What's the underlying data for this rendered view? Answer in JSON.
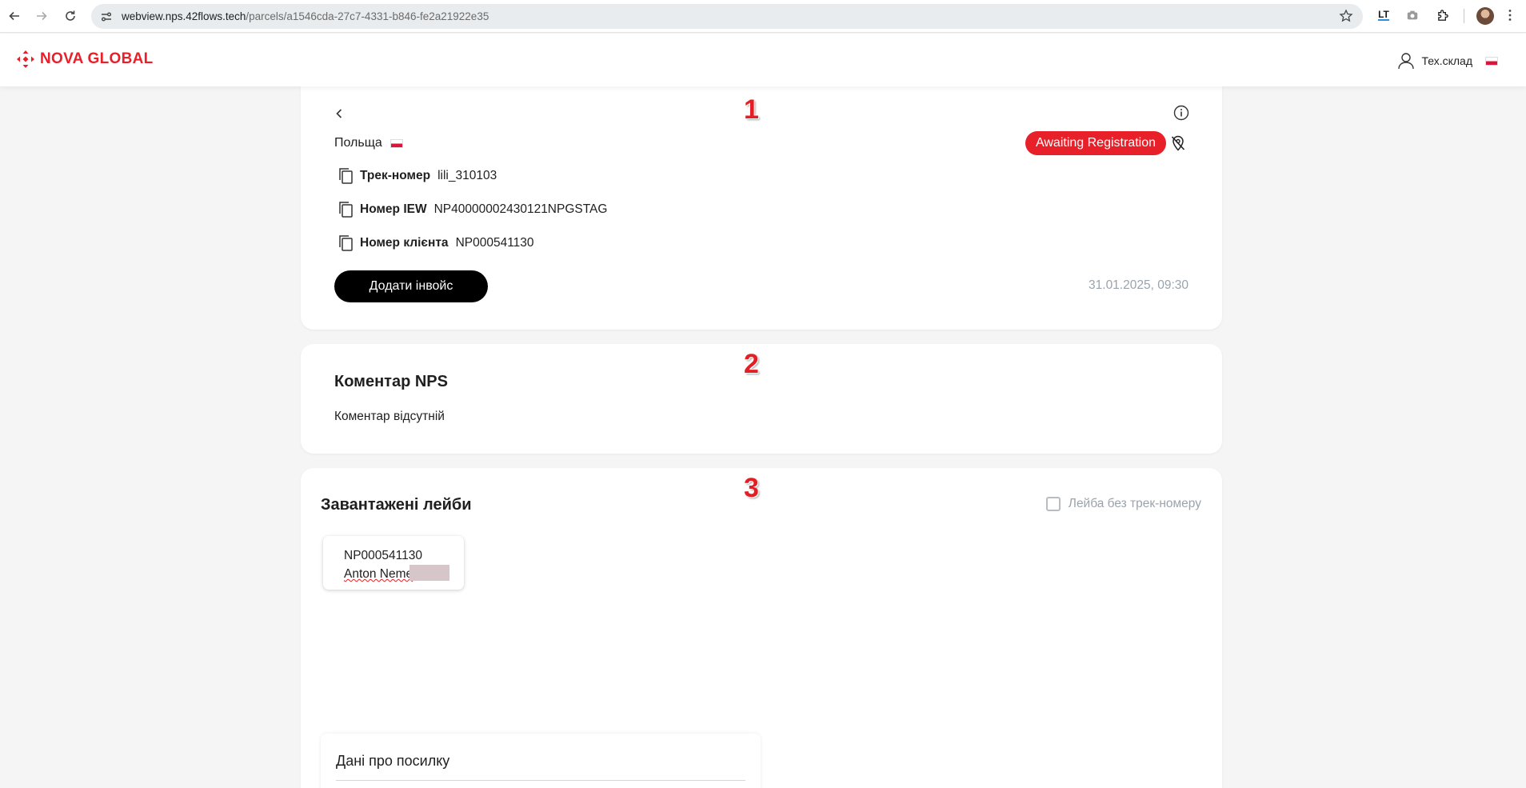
{
  "browser": {
    "url_host": "webview.nps.42flows.tech",
    "url_path": "/parcels/a1546cda-27c7-4331-b846-fe2a21922e35",
    "ext_label": "LT"
  },
  "header": {
    "logo": "NOVA GLOBAL",
    "user": "Тех.склад"
  },
  "card1": {
    "badge": "1",
    "country": "Польща",
    "status": "Awaiting Registration",
    "rows": [
      {
        "label": "Трек-номер",
        "value": "lili_310103"
      },
      {
        "label": "Номер IEW",
        "value": "NP40000002430121NPGSTAG"
      },
      {
        "label": "Номер клієнта",
        "value": "NP000541130"
      }
    ],
    "add_invoice": "Додати інвойс",
    "date": "31.01.2025, 09:30"
  },
  "card2": {
    "badge": "2",
    "title": "Коментар NPS",
    "text": "Коментар відсутній"
  },
  "card3": {
    "badge": "3",
    "title": "Завантажені лейби",
    "checkbox_label": "Лейба без трек-номеру",
    "label_item": {
      "number": "NP000541130",
      "name": "Anton Neme"
    },
    "parcel_title": "Дані про посилку"
  },
  "colors": {
    "brand": "#e8202a",
    "badge": "#e31e24"
  }
}
